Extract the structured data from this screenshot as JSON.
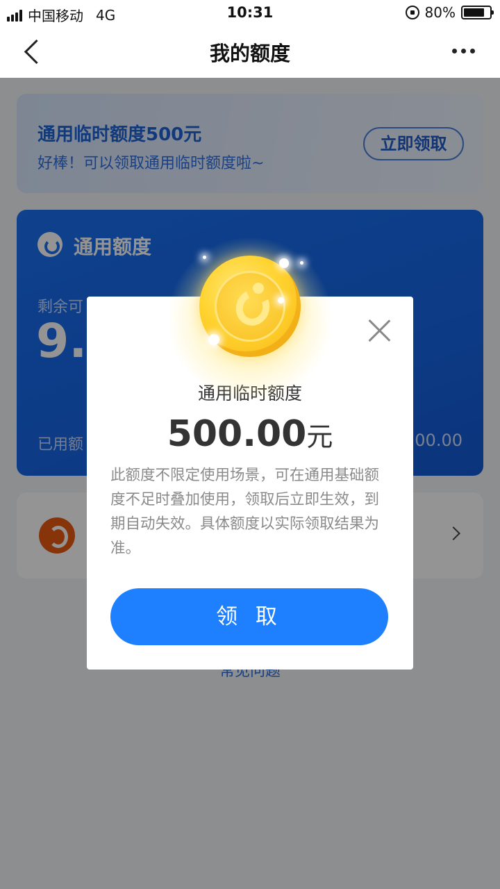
{
  "status_bar": {
    "carrier": "中国移动",
    "network": "4G",
    "time": "10:31",
    "battery": "80%",
    "battery_level": 0.8
  },
  "nav": {
    "title": "我的额度"
  },
  "temp_card": {
    "title": "通用临时额度500元",
    "subtitle": "好棒！可以领取通用临时额度啦~",
    "button": "立即领取"
  },
  "credit_card": {
    "title": "通用额度",
    "remain_label": "剩余可",
    "remain_amount": "9.5",
    "used_label": "已用额",
    "total_amount": "00.00"
  },
  "faq": {
    "label": "常见问题"
  },
  "modal": {
    "title": "通用临时额度",
    "amount": "500.00",
    "unit": "元",
    "description": "此额度不限定使用场景，可在通用基础额度不足时叠加使用，领取后立即生效，到期自动失效。具体额度以实际领取结果为准。",
    "button": "领 取"
  },
  "colors": {
    "primary": "#1e80ff",
    "card_blue": "#1766e6",
    "partner_orange": "#e85a12",
    "coin_gold": "#ffd22e"
  }
}
